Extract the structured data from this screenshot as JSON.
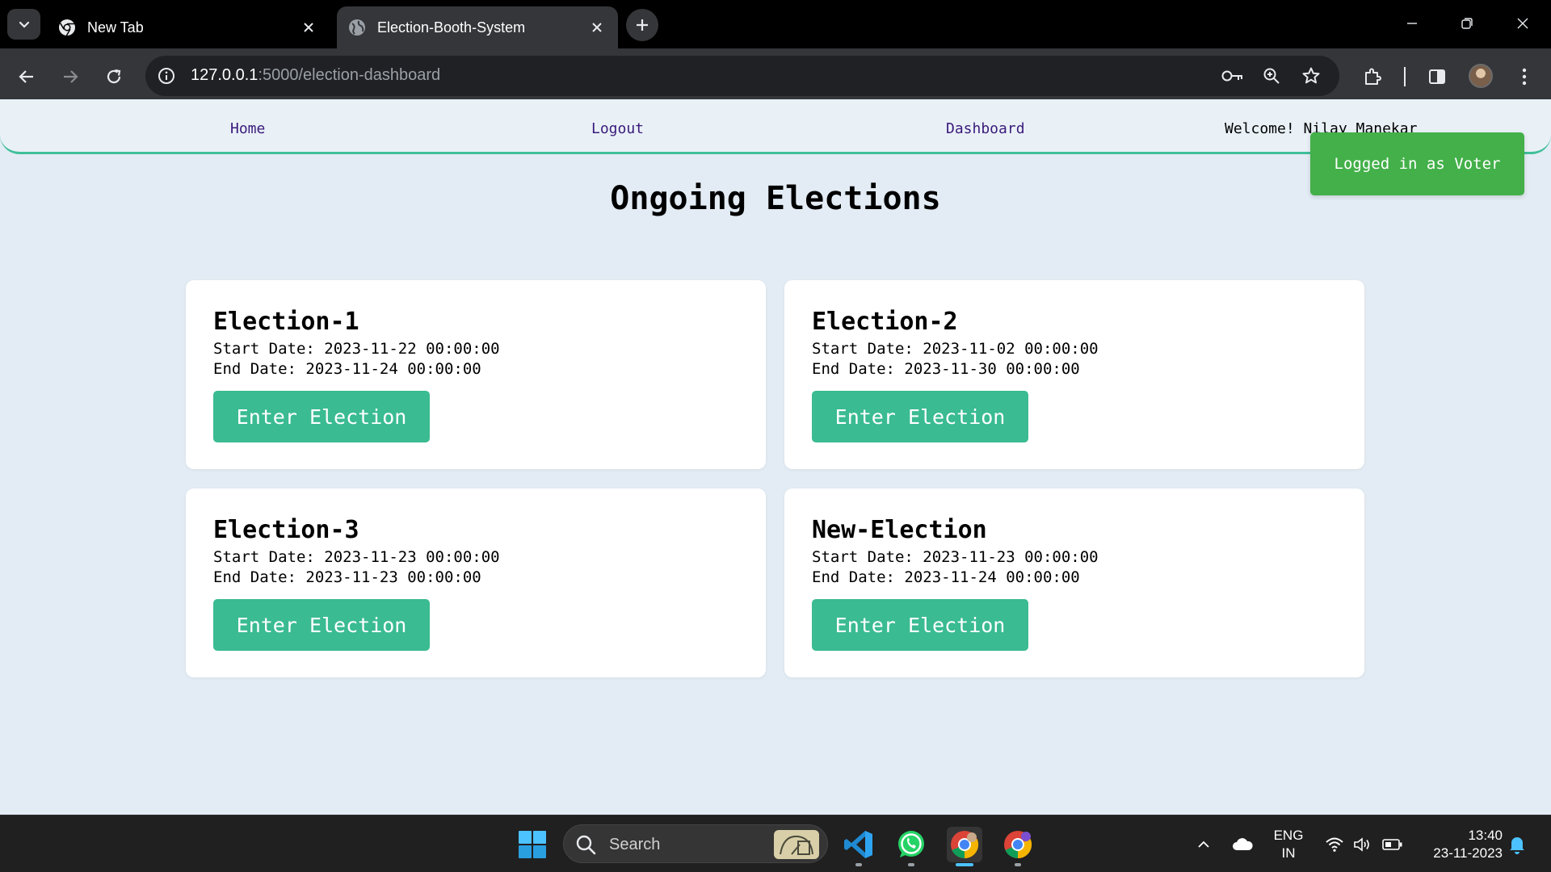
{
  "browser": {
    "tabs": [
      {
        "title": "New Tab"
      },
      {
        "title": "Election-Booth-System"
      }
    ],
    "url": {
      "host": "127.0.0.1",
      "rest": ":5000/election-dashboard"
    }
  },
  "nav": {
    "home": "Home",
    "logout": "Logout",
    "dashboard": "Dashboard",
    "welcome": "Welcome! Nilay Manekar"
  },
  "toast": "Logged in as Voter",
  "page_title": "Ongoing Elections",
  "elections": [
    {
      "name": "Election-1",
      "start": "Start Date: 2023-11-22 00:00:00",
      "end": "End Date: 2023-11-24 00:00:00",
      "button": "Enter Election"
    },
    {
      "name": "Election-2",
      "start": "Start Date: 2023-11-02 00:00:00",
      "end": "End Date: 2023-11-30 00:00:00",
      "button": "Enter Election"
    },
    {
      "name": "Election-3",
      "start": "Start Date: 2023-11-23 00:00:00",
      "end": "End Date: 2023-11-23 00:00:00",
      "button": "Enter Election"
    },
    {
      "name": "New-Election",
      "start": "Start Date: 2023-11-23 00:00:00",
      "end": "End Date: 2023-11-24 00:00:00",
      "button": "Enter Election"
    }
  ],
  "taskbar": {
    "search": "Search",
    "lang": {
      "line1": "ENG",
      "line2": "IN"
    },
    "time": "13:40",
    "date": "23-11-2023"
  },
  "colors": {
    "accent": "#3abb91",
    "toast": "#43b049",
    "nav_border": "#3fbf9a",
    "page_bg": "#e3ecf4"
  },
  "icons": [
    "tab-search-icon",
    "chrome-icon",
    "globe-icon",
    "close-icon",
    "plus-icon",
    "minimize-icon",
    "restore-icon",
    "back-icon",
    "forward-icon",
    "reload-icon",
    "info-icon",
    "key-icon",
    "zoom-icon",
    "star-icon",
    "extensions-icon",
    "side-panel-icon",
    "menu-icon",
    "windows-start-icon",
    "vscode-icon",
    "whatsapp-icon",
    "chrome-icon",
    "wifi-icon",
    "volume-icon",
    "battery-icon",
    "cloud-icon",
    "bell-icon"
  ]
}
